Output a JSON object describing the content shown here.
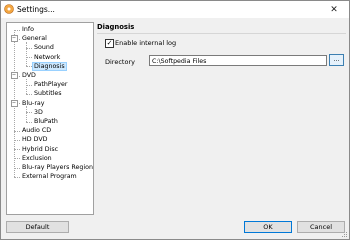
{
  "window": {
    "title": "Settings...",
    "close_glyph": "✕"
  },
  "tree": {
    "items": [
      {
        "label": "Info",
        "level": 0,
        "toggle": ""
      },
      {
        "label": "General",
        "level": 0,
        "toggle": "−"
      },
      {
        "label": "Sound",
        "level": 1,
        "toggle": ""
      },
      {
        "label": "Network",
        "level": 1,
        "toggle": ""
      },
      {
        "label": "Diagnosis",
        "level": 1,
        "toggle": "",
        "selected": true
      },
      {
        "label": "DVD",
        "level": 0,
        "toggle": "−"
      },
      {
        "label": "PathPlayer",
        "level": 1,
        "toggle": ""
      },
      {
        "label": "Subtitles",
        "level": 1,
        "toggle": ""
      },
      {
        "label": "Blu-ray",
        "level": 0,
        "toggle": "−"
      },
      {
        "label": "3D",
        "level": 1,
        "toggle": ""
      },
      {
        "label": "BluPath",
        "level": 1,
        "toggle": ""
      },
      {
        "label": "Audio CD",
        "level": 0,
        "toggle": ""
      },
      {
        "label": "HD DVD",
        "level": 0,
        "toggle": ""
      },
      {
        "label": "Hybrid Disc",
        "level": 0,
        "toggle": ""
      },
      {
        "label": "Exclusion",
        "level": 0,
        "toggle": ""
      },
      {
        "label": "Blu-ray Players Region",
        "level": 0,
        "toggle": ""
      },
      {
        "label": "External Program",
        "level": 0,
        "toggle": ""
      }
    ]
  },
  "panel": {
    "title": "Diagnosis",
    "enable_log_label": "Enable internal log",
    "enable_log_checked": true,
    "check_glyph": "✓",
    "directory_label": "Directory",
    "directory_value": "C:\\Softpedia Files",
    "browse_label": "..."
  },
  "buttons": {
    "default_label": "Default",
    "ok_label": "OK",
    "cancel_label": "Cancel"
  },
  "colors": {
    "selection": "#cce8ff",
    "ok_border": "#0078d7"
  }
}
